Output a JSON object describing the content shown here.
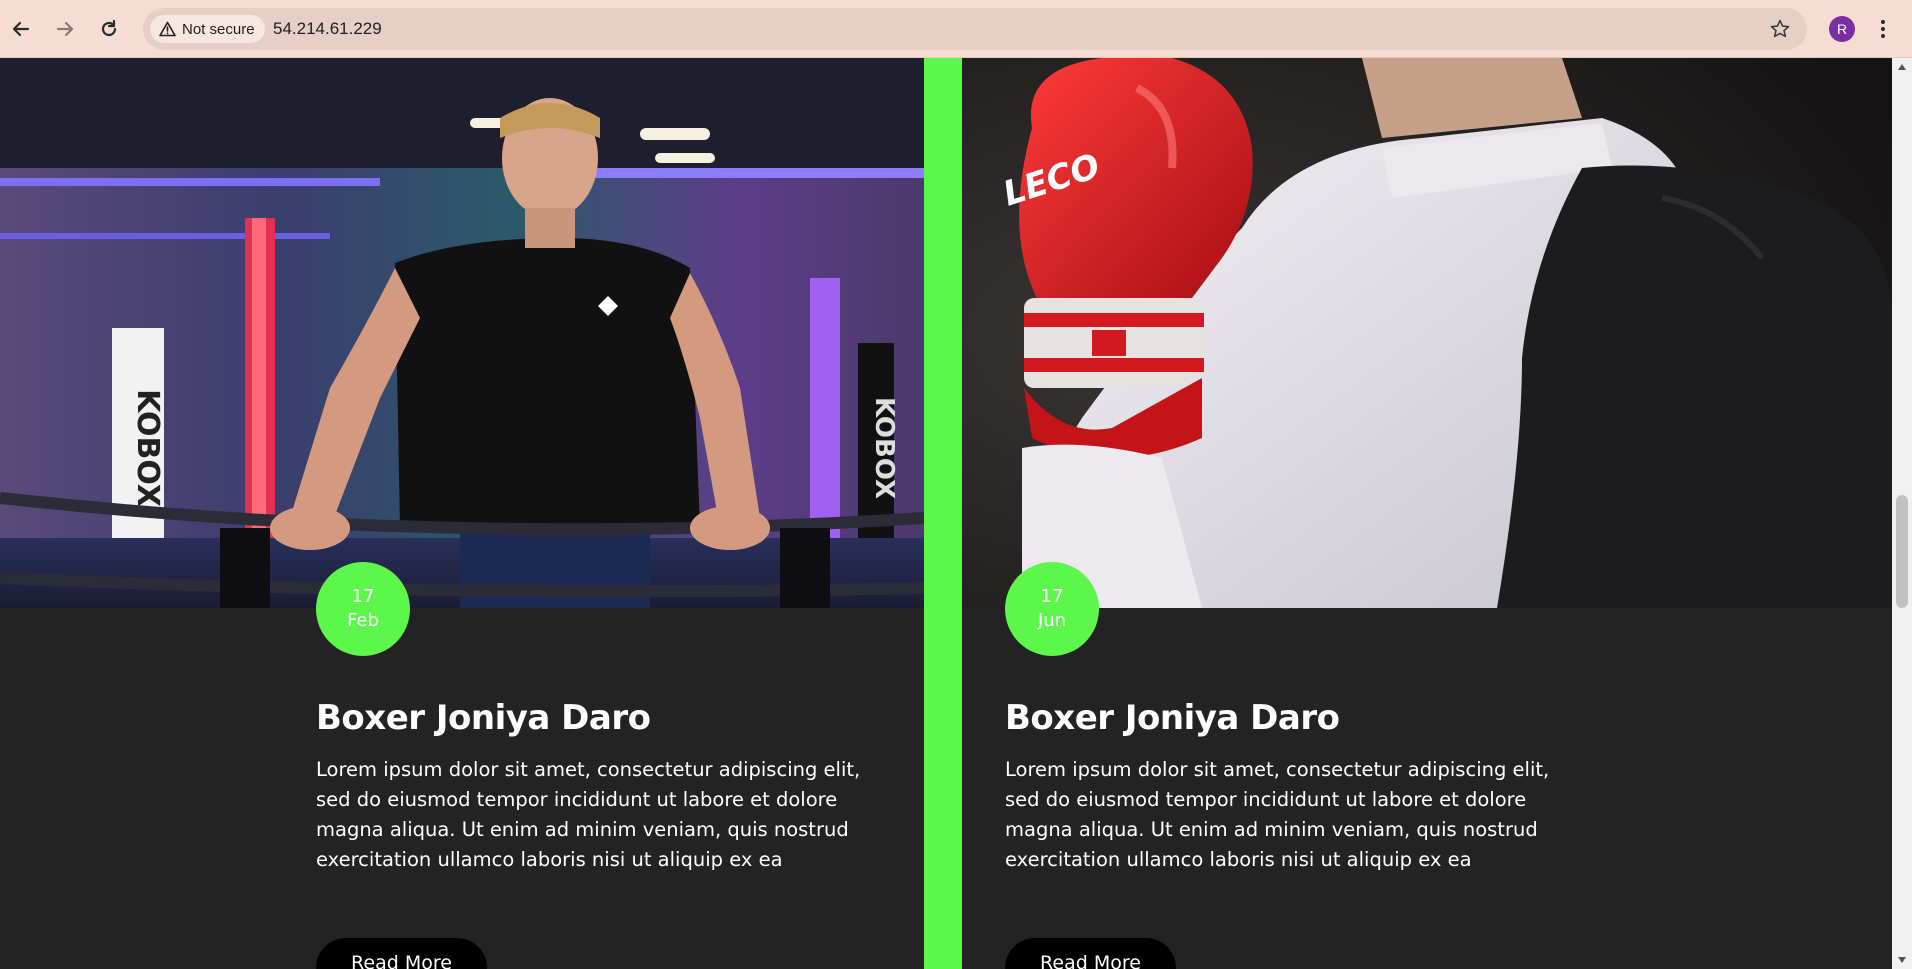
{
  "browser": {
    "security_label": "Not secure",
    "url": "54.214.61.229",
    "profile_initial": "R",
    "icons": {
      "back": "arrow-left",
      "forward": "arrow-right",
      "reload": "reload",
      "warning": "warning-triangle",
      "bookmark": "star-outline",
      "menu": "vertical-dots"
    }
  },
  "colors": {
    "accent": "#5cf74a",
    "card_bg": "#232323",
    "button_bg": "#000000"
  },
  "cards": [
    {
      "day": "17",
      "month": "Feb",
      "title": "Boxer Joniya Daro",
      "text": "Lorem ipsum dolor sit amet, consectetur adipiscing elit, sed do eiusmod tempor incididunt ut labore et dolore magna aliqua. Ut enim ad minim veniam, quis nostrud exercitation ullamco laboris nisi ut aliquip ex ea",
      "button": "Read More",
      "banner_text": "KOBOX"
    },
    {
      "day": "17",
      "month": "Jun",
      "title": "Boxer Joniya Daro",
      "text": "Lorem ipsum dolor sit amet, consectetur adipiscing elit, sed do eiusmod tempor incididunt ut labore et dolore magna aliqua. Ut enim ad minim veniam, quis nostrud exercitation ullamco laboris nisi ut aliquip ex ea",
      "button": "Read More",
      "glove_text": "LECO"
    }
  ]
}
